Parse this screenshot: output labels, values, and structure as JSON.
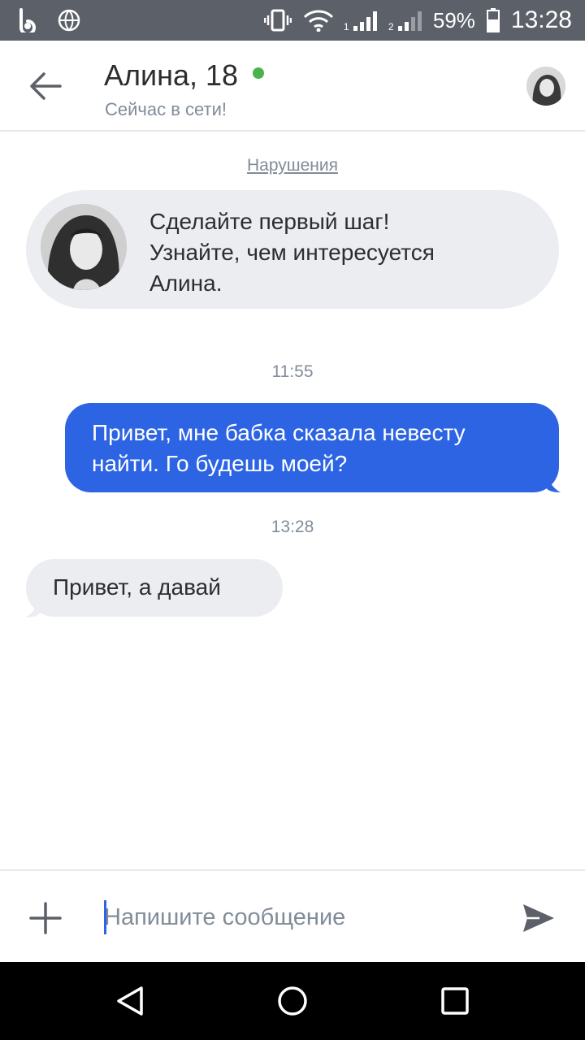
{
  "status_bar": {
    "battery": "59%",
    "time": "13:28",
    "sim1_label": "1",
    "sim2_label": "2"
  },
  "header": {
    "title": "Алина, 18",
    "status": "Сейчас в сети!"
  },
  "chat": {
    "report_link": "Нарушения",
    "intro_text": "Сделайте первый шаг!\nУзнайте, чем интересуется\nАлина.",
    "messages": [
      {
        "time": "11:55",
        "direction": "outgoing",
        "text": "Привет, мне бабка сказала невесту найти. Го будешь моей?"
      },
      {
        "time": "13:28",
        "direction": "incoming",
        "text": "Привет, а давай"
      }
    ]
  },
  "composer": {
    "placeholder": "Напишите сообщение"
  },
  "colors": {
    "accent": "#2d64e3",
    "online": "#4bb34b",
    "incoming_bubble": "#ebedf0",
    "muted_text": "#818c99"
  }
}
